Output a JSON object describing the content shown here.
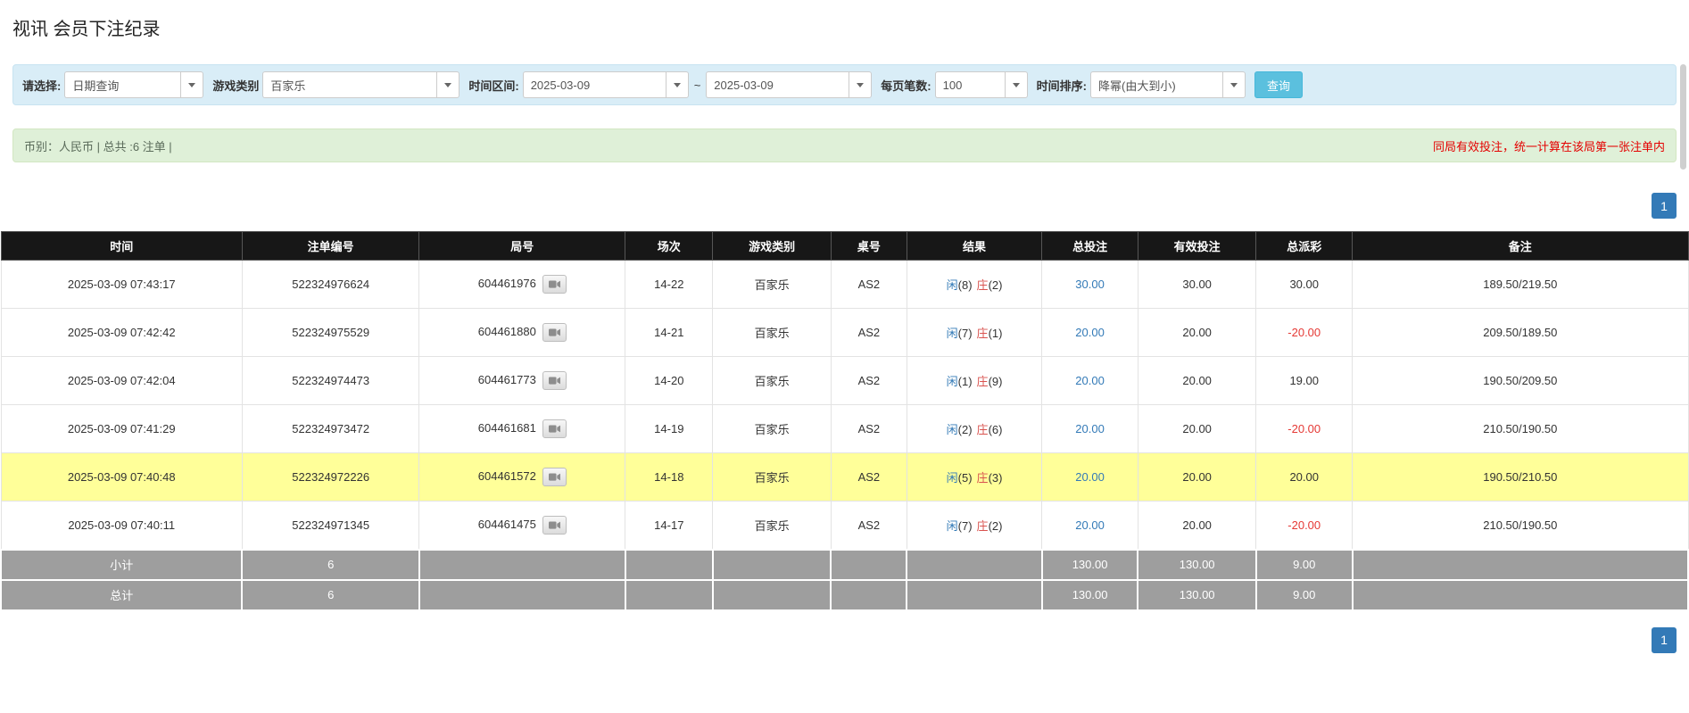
{
  "page": {
    "title": "视讯 会员下注纪录"
  },
  "filters": {
    "query_type": {
      "label": "请选择:",
      "value": "日期查询"
    },
    "game_type": {
      "label": "游戏类别",
      "value": "百家乐"
    },
    "date_range": {
      "label": "时间区间:",
      "from": "2025-03-09",
      "separator": "~",
      "to": "2025-03-09"
    },
    "page_size": {
      "label": "每页笔数:",
      "value": "100"
    },
    "sort": {
      "label": "时间排序:",
      "value": "降幂(由大到小)"
    },
    "search_button_label": "查询"
  },
  "summary": {
    "currency_info": "币别：人民币 | 总共 :6 注单 |",
    "notice": "同局有效投注，统一计算在该局第一张注单内"
  },
  "pagination": {
    "current_page": "1"
  },
  "table": {
    "headers": [
      "时间",
      "注单编号",
      "局号",
      "场次",
      "游戏类别",
      "桌号",
      "结果",
      "总投注",
      "有效投注",
      "总派彩",
      "备注"
    ],
    "rows": [
      {
        "time": "2025-03-09 07:43:17",
        "bet_id": "522324976624",
        "round_id": "604461976",
        "session": "14-22",
        "game": "百家乐",
        "table_no": "AS2",
        "result_player": "闲",
        "result_player_score": "(8)",
        "result_banker": "庄",
        "result_banker_score": "(2)",
        "total_bet": "30.00",
        "valid_bet": "30.00",
        "payout": "30.00",
        "remark": "189.50/219.50",
        "highlighted": false
      },
      {
        "time": "2025-03-09 07:42:42",
        "bet_id": "522324975529",
        "round_id": "604461880",
        "session": "14-21",
        "game": "百家乐",
        "table_no": "AS2",
        "result_player": "闲",
        "result_player_score": "(7)",
        "result_banker": "庄",
        "result_banker_score": "(1)",
        "total_bet": "20.00",
        "valid_bet": "20.00",
        "payout": "-20.00",
        "remark": "209.50/189.50",
        "highlighted": false
      },
      {
        "time": "2025-03-09 07:42:04",
        "bet_id": "522324974473",
        "round_id": "604461773",
        "session": "14-20",
        "game": "百家乐",
        "table_no": "AS2",
        "result_player": "闲",
        "result_player_score": "(1)",
        "result_banker": "庄",
        "result_banker_score": "(9)",
        "total_bet": "20.00",
        "valid_bet": "20.00",
        "payout": "19.00",
        "remark": "190.50/209.50",
        "highlighted": false
      },
      {
        "time": "2025-03-09 07:41:29",
        "bet_id": "522324973472",
        "round_id": "604461681",
        "session": "14-19",
        "game": "百家乐",
        "table_no": "AS2",
        "result_player": "闲",
        "result_player_score": "(2)",
        "result_banker": "庄",
        "result_banker_score": "(6)",
        "total_bet": "20.00",
        "valid_bet": "20.00",
        "payout": "-20.00",
        "remark": "210.50/190.50",
        "highlighted": false
      },
      {
        "time": "2025-03-09 07:40:48",
        "bet_id": "522324972226",
        "round_id": "604461572",
        "session": "14-18",
        "game": "百家乐",
        "table_no": "AS2",
        "result_player": "闲",
        "result_player_score": "(5)",
        "result_banker": "庄",
        "result_banker_score": "(3)",
        "total_bet": "20.00",
        "valid_bet": "20.00",
        "payout": "20.00",
        "remark": "190.50/210.50",
        "highlighted": true
      },
      {
        "time": "2025-03-09 07:40:11",
        "bet_id": "522324971345",
        "round_id": "604461475",
        "session": "14-17",
        "game": "百家乐",
        "table_no": "AS2",
        "result_player": "闲",
        "result_player_score": "(7)",
        "result_banker": "庄",
        "result_banker_score": "(2)",
        "total_bet": "20.00",
        "valid_bet": "20.00",
        "payout": "-20.00",
        "remark": "210.50/190.50",
        "highlighted": false
      }
    ],
    "subtotal": {
      "label": "小计",
      "count": "6",
      "total_bet": "130.00",
      "valid_bet": "130.00",
      "payout": "9.00"
    },
    "grand_total": {
      "label": "总计",
      "count": "6",
      "total_bet": "130.00",
      "valid_bet": "130.00",
      "payout": "9.00"
    }
  },
  "icons": {
    "round_replay": "video-camera-icon",
    "dropdown": "caret-down-icon"
  },
  "colors": {
    "filter_bar_bg": "#d9edf7",
    "summary_bar_bg": "#dff0d8",
    "notice_red": "#e40000",
    "table_header_bg": "#171717",
    "highlight_row": "#ffff99",
    "footer_row_bg": "#9e9e9e",
    "link_blue": "#337ab7",
    "player_blue": "#337ab7",
    "banker_red": "#d9534f",
    "negative_red": "#e53935",
    "search_button_bg": "#5bc0de",
    "pagination_active_bg": "#337ab7"
  }
}
